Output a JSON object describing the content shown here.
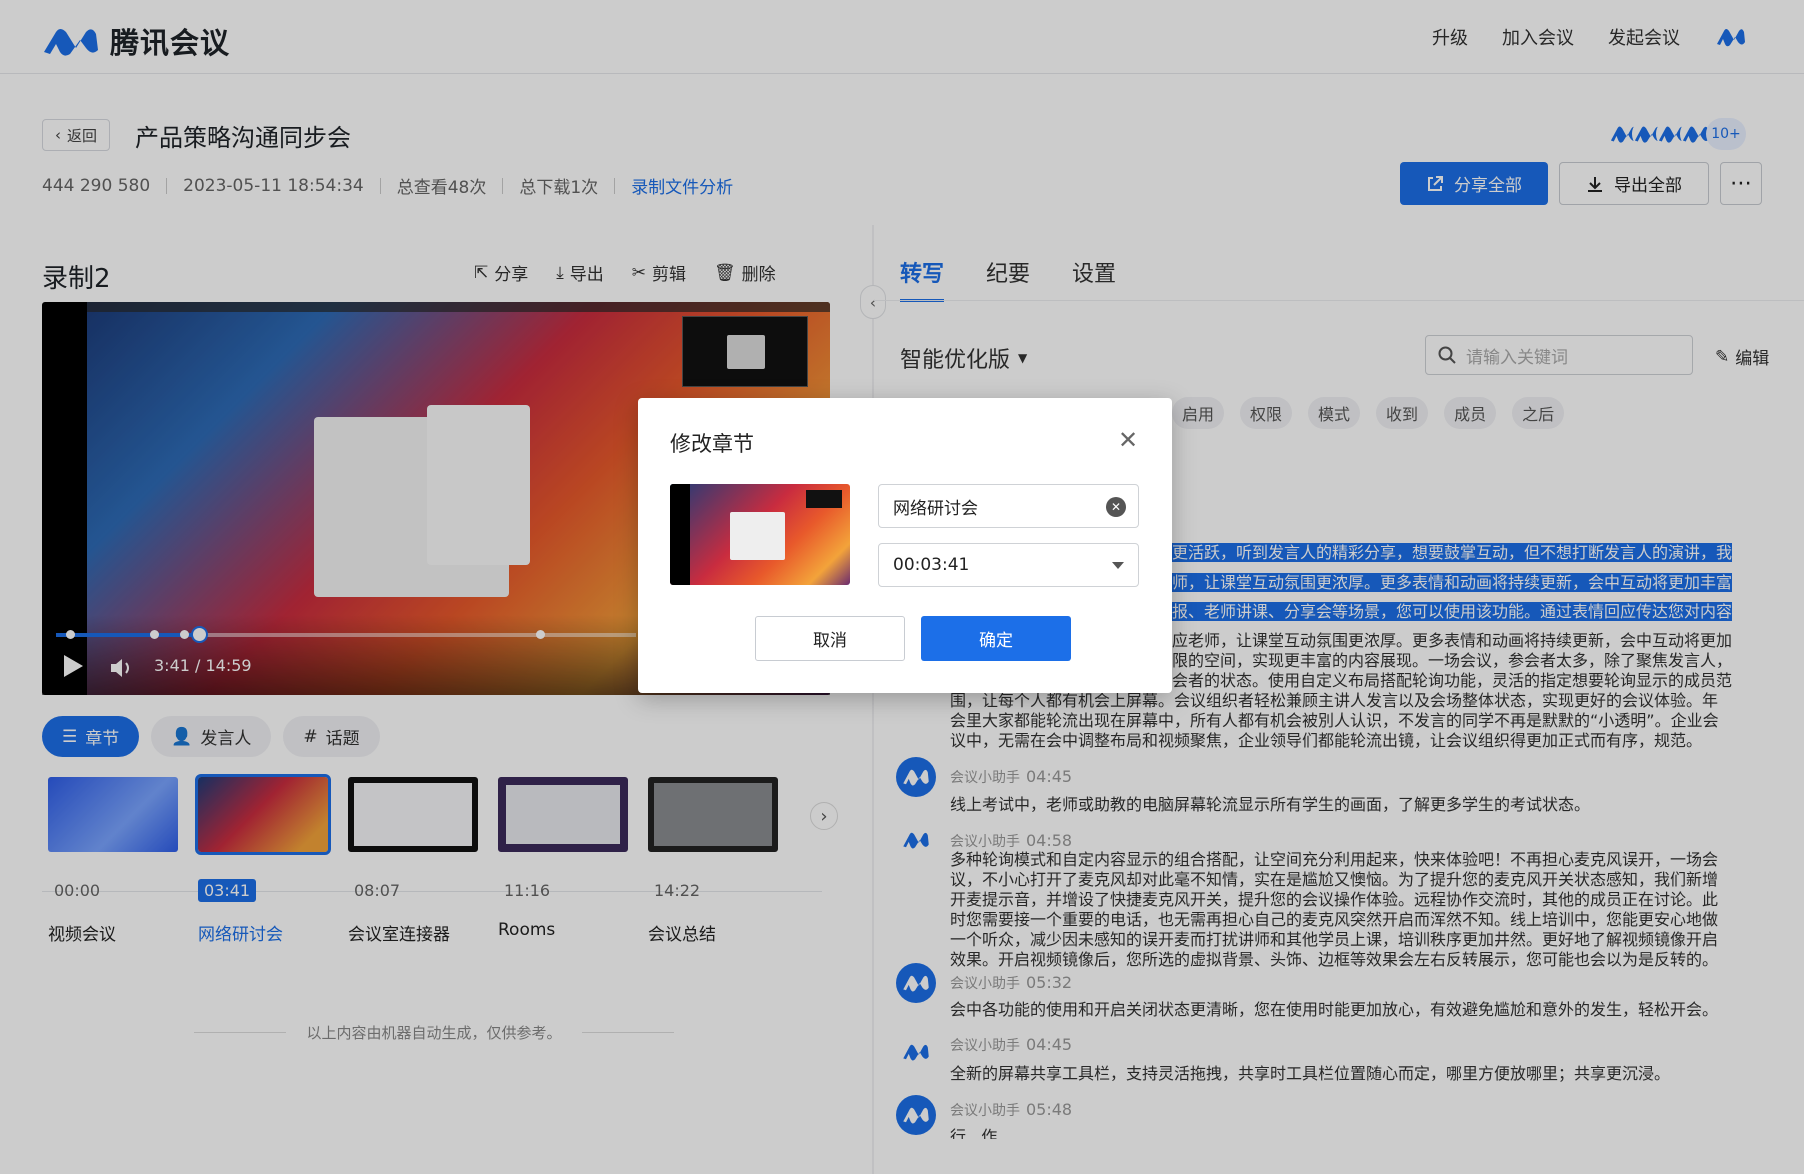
{
  "brand": {
    "name": "腾讯会议"
  },
  "topnav": [
    "升级",
    "加入会议",
    "发起会议"
  ],
  "meeting": {
    "back": "返回",
    "title": "产品策略沟通同步会",
    "id": "444 290 580",
    "datetime": "2023-05-11 18:54:34",
    "views": "总查看48次",
    "downloads": "总下载1次",
    "analysis": "录制文件分析",
    "participants_more": "10+"
  },
  "actions": {
    "share_all": "分享全部",
    "export_all": "导出全部",
    "more": "⋯"
  },
  "recording": {
    "title": "录制2",
    "actions": [
      "分享",
      "导出",
      "剪辑",
      "删除"
    ],
    "time": "3:41 / 14:59",
    "progress": 0.247
  },
  "left_tabs": [
    "章节",
    "发言人",
    "话题"
  ],
  "chapters": [
    {
      "time": "00:00",
      "name": "视频会议"
    },
    {
      "time": "03:41",
      "name": "网络研讨会",
      "active": true
    },
    {
      "time": "08:07",
      "name": "会议室连接器"
    },
    {
      "time": "11:16",
      "name": "Rooms"
    },
    {
      "time": "14:22",
      "name": "会议总结"
    }
  ],
  "note": "以上内容由机器自动生成，仅供参考。",
  "right_tabs": [
    "转写",
    "纪要",
    "设置"
  ],
  "transcript": {
    "version": "智能优化版",
    "search_placeholder": "请输入关键词",
    "edit": "编辑",
    "keywords": [
      "启用",
      "权限",
      "模式",
      "收到",
      "成员",
      "之后"
    ],
    "hl_lines": [
      "更活跃，听到发言人的精彩分享，想要鼓掌互动，但不想打断发言人的演讲，我",
      "师，让课堂互动氛围更浓厚。更多表情和动画将持续更新，会中互动将更加丰富",
      "报、老师讲课、分享会等场景，您可以使用该功能。通过表情回应传达您对内容"
    ],
    "para1_lines": [
      "应老师，让课堂互动氛围更浓厚。更多表情和动画将持续更新，会中互动将更加",
      "限的空间，实现更丰富的内容展现。一场会议，参会者太多，除了聚焦发言人，",
      "会者的状态。使用自定义布局搭配轮询功能，灵活的指定想要轮询显示的成员范",
      "围，让每个人都有机会上屏幕。会议组织者轻松兼顾主讲人发言以及会场整体状态，实现更好的会议体验。年",
      "会里大家都能轮流出现在屏幕中，所有人都有机会被別人认识，不发言的同学不再是默默的“小透明”。企业会",
      "议中，无需在会中调整布局和视频聚焦，企业领导们都能轮流出镜，让会议组织得更加正式而有序，规范。"
    ],
    "entries": [
      {
        "speaker": "会议小助手",
        "time": "04:45",
        "lines": [
          "线上考试中，老师或助教的电脑屏幕轮流显示所有学生的画面，了解更多学生的考试状态。"
        ]
      },
      {
        "speaker": "会议小助手",
        "time": "04:58",
        "lines": [
          "多种轮询模式和自定内容显示的组合搭配，让空间充分利用起来，快来体验吧！不再担心麦克风误开，一场会",
          "议，不小心打开了麦克风却对此毫不知情，实在是尴尬又懊恼。为了提升您的麦克风开关状态感知，我们新增",
          "开麦提示音，并增设了快捷麦克风开关，提升您的会议操作体验。远程协作交流时，其他的成员正在讨论。此",
          "时您需要接一个重要的电话，也无需再担心自己的麦克风突然开启而浑然不知。线上培训中，您能更安心地做",
          "一个听众，减少因未感知的误开麦而打扰讲师和其他学员上课，培训秩序更加井然。更好地了解视频镜像开启",
          "效果。开启视频镜像后，您所选的虚拟背景、头饰、边框等效果会左右反转展示，您可能也会以为是反转的。"
        ]
      },
      {
        "speaker": "会议小助手",
        "time": "05:32",
        "lines": [
          "会中各功能的使用和开启关闭状态更清晰，您在使用时能更加放心，有效避免尴尬和意外的发生，轻松开会。"
        ]
      },
      {
        "speaker": "会议小助手",
        "time": "04:45",
        "lines": [
          "全新的屏幕共享工具栏，支持灵活拖拽，共享时工具栏位置随心而定，哪里方便放哪里；共享更沉浸。"
        ]
      },
      {
        "speaker": "会议小助手",
        "time": "05:48",
        "lines": [
          "行...作..."
        ]
      }
    ]
  },
  "modal": {
    "title": "修改章节",
    "name_value": "网络研讨会",
    "time_value": "00:03:41",
    "cancel": "取消",
    "confirm": "确定"
  },
  "colors": {
    "accent": "#1c6fe8"
  }
}
